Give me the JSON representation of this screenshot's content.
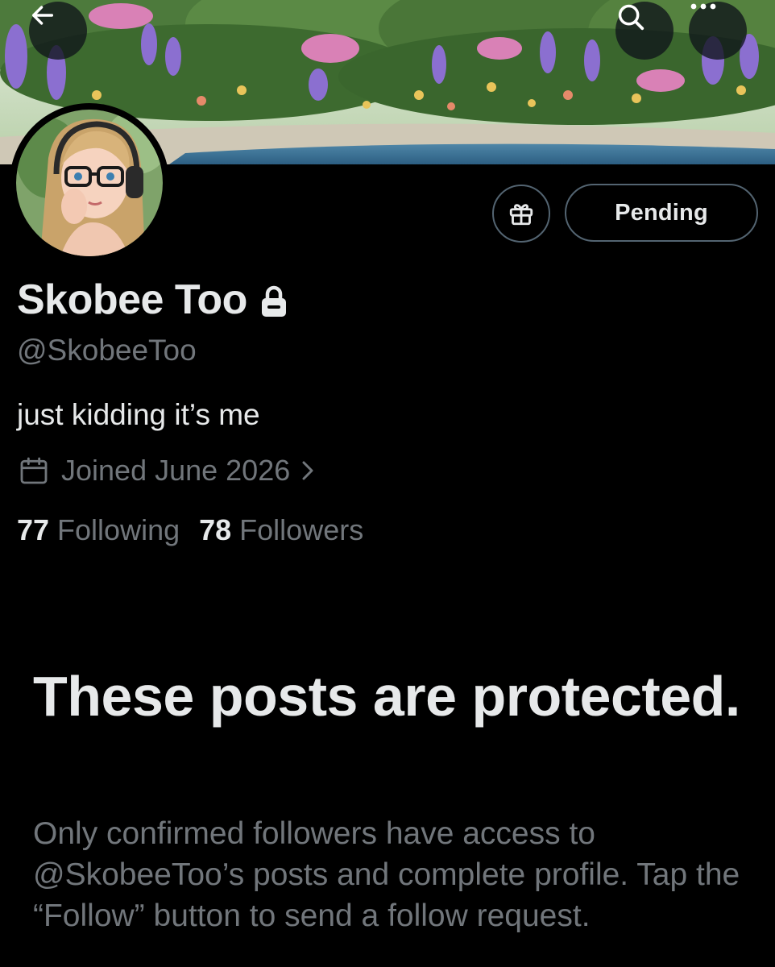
{
  "header": {
    "back_icon": "arrow-left-icon",
    "search_icon": "search-icon",
    "more_icon": "more-horizontal-icon"
  },
  "actions": {
    "gift_icon": "gift-icon",
    "pending_label": "Pending"
  },
  "profile": {
    "display_name": "Skobee Too",
    "handle": "@SkobeeToo",
    "bio": "just kidding it’s me",
    "joined": "Joined June 2026",
    "following_count": "77",
    "following_label": "Following",
    "followers_count": "78",
    "followers_label": "Followers"
  },
  "protected": {
    "title": "These posts are protected.",
    "body": "Only confirmed followers have access to @SkobeeToo’s posts and complete profile. Tap the “Follow” button to send a follow request."
  },
  "colors": {
    "background": "#000000",
    "primary_text": "#e7e9ea",
    "secondary_text": "#71767b",
    "border": "#536471"
  }
}
